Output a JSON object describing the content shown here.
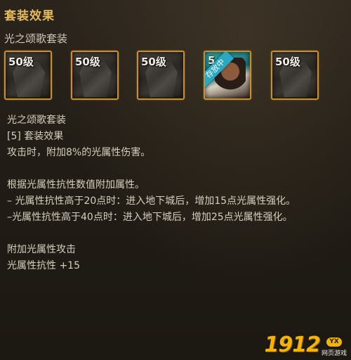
{
  "header": {
    "title": "套装效果",
    "set_name": "光之颂歌套装"
  },
  "slots": [
    {
      "level": "50级",
      "icon": "coat-icon"
    },
    {
      "level": "50级",
      "icon": "shirt-icon"
    },
    {
      "level": "50级",
      "icon": "pants-icon"
    },
    {
      "level": "5",
      "icon": "portrait-icon",
      "badge": "存放中"
    },
    {
      "level": "50级",
      "icon": "shoes-icon"
    }
  ],
  "details": {
    "set_name": "光之颂歌套装",
    "effect_heading": "[5] 套装效果",
    "effect_line1": "攻击时，附加8%的光属性伤害。",
    "resist_intro": "根据光属性抗性数值附加属性。",
    "resist_20": "– 光属性抗性高于20点时：进入地下城后，增加15点光属性强化。",
    "resist_40": "–光属性抗性高于40点时：进入地下城后，增加25点光属性强化。",
    "attack_heading": "附加光属性攻击",
    "resist_stat": "光属性抗性 +15"
  },
  "watermark": {
    "number": "1912",
    "badge": "YX",
    "sub": "网页游戏"
  },
  "colors": {
    "title": "#e6b95a",
    "slot_border": "#c98f2a",
    "text": "#d6cfbf"
  }
}
